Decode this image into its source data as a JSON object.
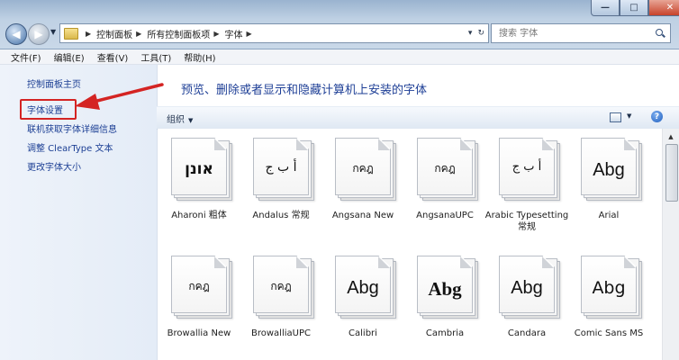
{
  "window": {
    "controls": {
      "minimize": "—",
      "maximize": "□",
      "close": "✕"
    }
  },
  "address_bar": {
    "breadcrumbs": [
      "控制面板",
      "所有控制面板项",
      "字体"
    ],
    "refresh_symbol": "↻",
    "dropdown_symbol": "▾"
  },
  "search": {
    "placeholder": "搜索 字体"
  },
  "menu": {
    "items": [
      "文件(F)",
      "编辑(E)",
      "查看(V)",
      "工具(T)",
      "帮助(H)"
    ]
  },
  "left_pane": {
    "links": [
      "控制面板主页",
      "字体设置",
      "联机获取字体详细信息",
      "调整 ClearType 文本",
      "更改字体大小"
    ],
    "highlighted_link": "字体设置"
  },
  "content": {
    "heading": "预览、删除或者显示和隐藏计算机上安装的字体",
    "toolbar": {
      "organize": "组织",
      "help": "?"
    },
    "fonts": [
      {
        "sample": "אונן",
        "name": "Aharoni 粗体"
      },
      {
        "sample": "أ ب ج",
        "name": "Andalus 常规"
      },
      {
        "sample": "กคฎ",
        "name": "Angsana New"
      },
      {
        "sample": "กคฎ",
        "name": "AngsanaUPC"
      },
      {
        "sample": "أ ب ج",
        "name": "Arabic Typesetting 常规"
      },
      {
        "sample": "Abg",
        "name": "Arial"
      },
      {
        "sample": "กคฎ",
        "name": "Browallia New"
      },
      {
        "sample": "กคฎ",
        "name": "BrowalliaUPC"
      },
      {
        "sample": "Abg",
        "name": "Calibri"
      },
      {
        "sample": "Abg",
        "name": "Cambria"
      },
      {
        "sample": "Abg",
        "name": "Candara"
      },
      {
        "sample": "Abg",
        "name": "Comic Sans MS"
      }
    ]
  },
  "colors": {
    "annotation_red": "#d42423",
    "link_blue": "#1c3f94",
    "heading_blue": "#1e3f96"
  }
}
